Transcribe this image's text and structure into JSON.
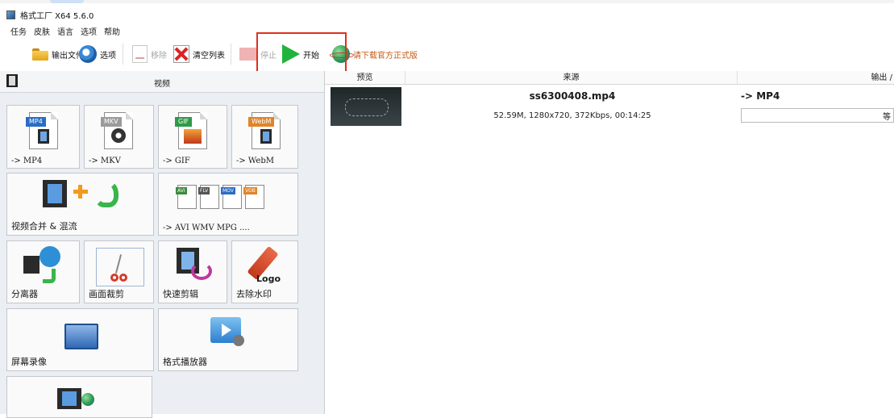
{
  "window": {
    "title": "格式工厂 X64 5.6.0"
  },
  "menu": [
    "任务",
    "皮肤",
    "语言",
    "选项",
    "帮助"
  ],
  "toolbar": {
    "output_folder": "输出文件夹",
    "options": "选项",
    "remove": "移除",
    "clear_list": "清空列表",
    "stop": "停止",
    "start": "开始",
    "download_official": "请下载官方正式版"
  },
  "left_panel": {
    "header": "视频",
    "tiles": {
      "to_mp4": "-> MP4",
      "to_mkv": "-> MKV",
      "to_gif": "-> GIF",
      "to_webm": "-> WebM",
      "merge_mux": "视频合并 & 混流",
      "to_avi_wmv_mpg": "-> AVI WMV MPG ....",
      "splitter": "分离器",
      "crop": "画面裁剪",
      "quick_clip": "快速剪辑",
      "remove_watermark": "去除水印",
      "screen_record": "屏幕录像",
      "format_player": "格式播放器"
    },
    "icon_tags": {
      "mp4": "MP4",
      "mkv": "MKV",
      "gif": "GIF",
      "webm": "WebM",
      "avi": "AVI",
      "flv": "FLV",
      "mov": "MOV",
      "vob": "VOB",
      "logo": "Logo"
    }
  },
  "file_list": {
    "columns": [
      "预览",
      "来源",
      "输出 /"
    ],
    "items": [
      {
        "name": "ss6300408.mp4",
        "info": "52.59M, 1280x720, 372Kbps, 00:14:25",
        "output_format": "-> MP4",
        "output_status": "等"
      }
    ]
  },
  "colors": {
    "highlight_box": "#e0301e",
    "start_green": "#22b33c",
    "link_orange": "#c45a12"
  }
}
